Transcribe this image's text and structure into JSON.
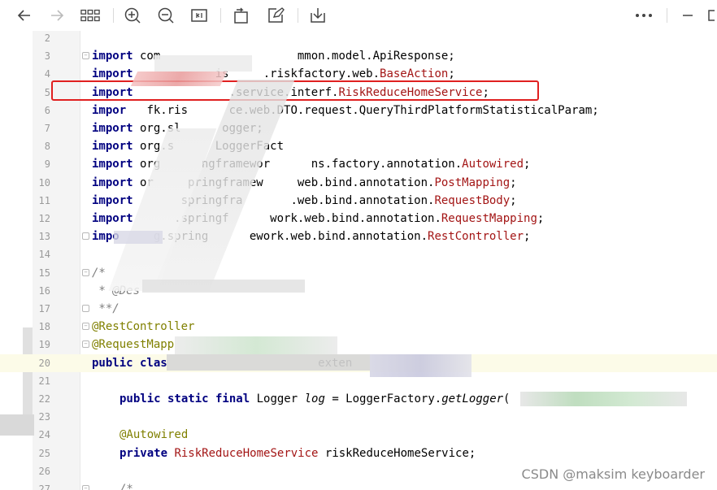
{
  "toolbar": {
    "icons": [
      "back-arrow-icon",
      "forward-arrow-icon",
      "grid-icon",
      "zoom-in-icon",
      "zoom-out-icon",
      "fit-width-icon",
      "rotate-icon",
      "edit-icon",
      "save-icon",
      "more-icon",
      "minimize-icon",
      "restore-icon"
    ]
  },
  "editor": {
    "lines": [
      {
        "n": "2",
        "text": ""
      },
      {
        "n": "3",
        "kw": "import",
        "rest": " com                    mmon.model.ApiResponse;"
      },
      {
        "n": "4",
        "kw": "import",
        "rest": "            is     .riskfactory.web.",
        "ref": "BaseAction",
        "tail": ";"
      },
      {
        "n": "5",
        "kw": "import",
        "rest": "              .service.interf.",
        "ref": "RiskReduceHomeService",
        "tail": ";"
      },
      {
        "n": "6",
        "kw": "impor",
        "rest": "   fk.ris      ce.web.DTO.request.QueryThirdPlatformStatisticalParam;"
      },
      {
        "n": "7",
        "kw": "import",
        "rest": " org.sl      ogger;"
      },
      {
        "n": "8",
        "kw": "import",
        "rest": " org.s      LoggerFact"
      },
      {
        "n": "9",
        "kw": "import",
        "rest": " org      ngframewor      ns.factory.annotation.",
        "ref": "Autowired",
        "tail": ";"
      },
      {
        "n": "10",
        "kw": "import",
        "rest": " or     pringframew     web.bind.annotation.",
        "ref": "PostMapping",
        "tail": ";"
      },
      {
        "n": "11",
        "kw": "import",
        "rest": "       springfra       .web.bind.annotation.",
        "ref": "RequestBody",
        "tail": ";"
      },
      {
        "n": "12",
        "kw": "import",
        "rest": "      .springf      work.web.bind.annotation.",
        "ref": "RequestMapping",
        "tail": ";"
      },
      {
        "n": "13",
        "kw": "impo",
        "rest": "     g.spring      ework.web.bind.annotation.",
        "ref": "RestController",
        "tail": ";"
      },
      {
        "n": "14",
        "text": ""
      },
      {
        "n": "15",
        "cmt": "/*"
      },
      {
        "n": "16",
        "cmt": " * @Des"
      },
      {
        "n": "17",
        "cmt": " **/"
      },
      {
        "n": "18",
        "ann": "@RestController"
      },
      {
        "n": "19",
        "ann": "@RequestMapp"
      },
      {
        "n": "20",
        "kw": "public clas",
        "rest": "                      exten"
      },
      {
        "n": "21",
        "text": ""
      },
      {
        "n": "22",
        "kw": "public static final",
        "rest": " Logger ",
        "ital": "log",
        "rest2": " = LoggerFactory.",
        "ital2": "getLogger",
        "tail": "("
      },
      {
        "n": "23",
        "text": ""
      },
      {
        "n": "24",
        "ann": "@Autowired"
      },
      {
        "n": "25",
        "kw": "private",
        "ref": "RiskReduceHomeService",
        "tail": " riskReduceHomeService;"
      },
      {
        "n": "26",
        "text": ""
      },
      {
        "n": "27",
        "cmt": "/*"
      }
    ]
  },
  "watermark": "CSDN @maksim keyboarder"
}
